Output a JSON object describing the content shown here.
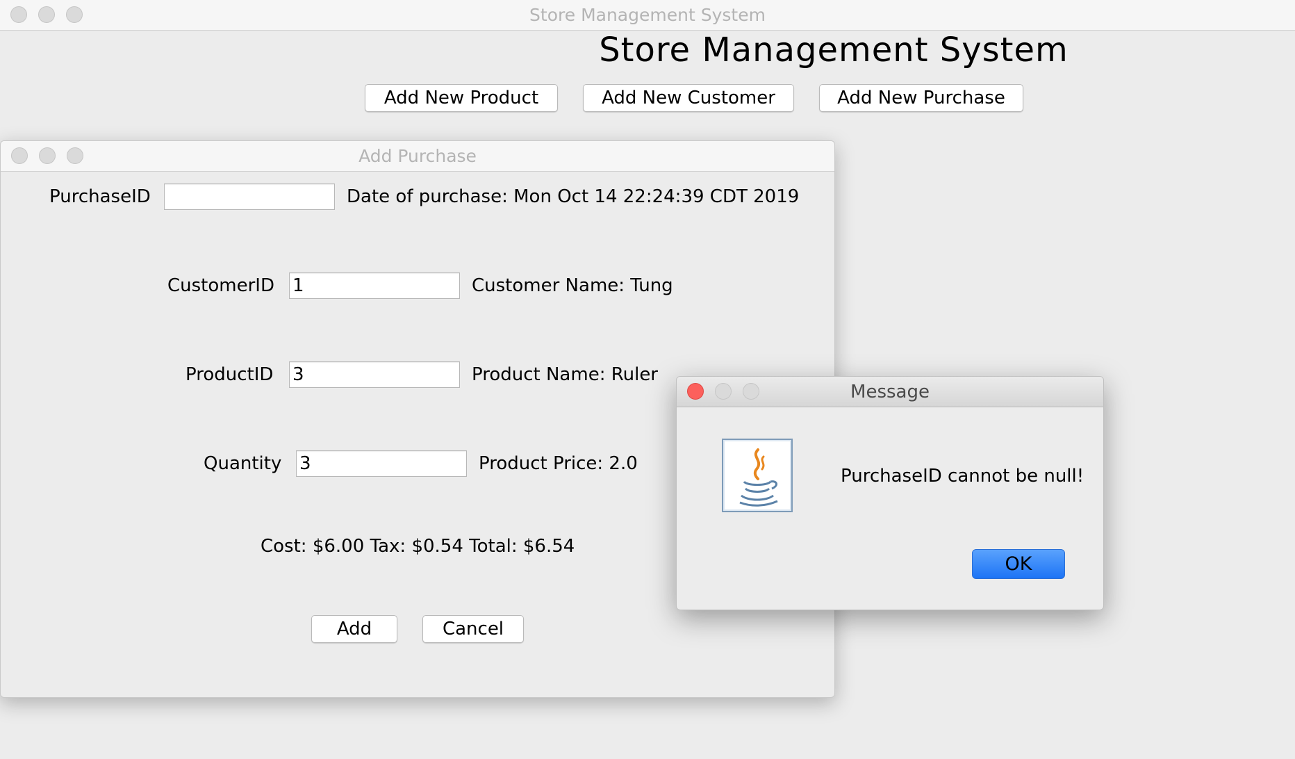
{
  "main_window": {
    "title": "Store Management System",
    "heading": "Store Management System",
    "buttons": {
      "add_product": "Add New Product",
      "add_customer": "Add New Customer",
      "add_purchase": "Add New Purchase"
    }
  },
  "purchase_window": {
    "title": "Add Purchase",
    "purchase_id": {
      "label": "PurchaseID",
      "value": ""
    },
    "date_text": "Date of purchase: Mon Oct 14 22:24:39 CDT 2019",
    "customer_id": {
      "label": "CustomerID",
      "value": "1"
    },
    "customer_name_text": "Customer Name: Tung",
    "product_id": {
      "label": "ProductID",
      "value": "3"
    },
    "product_name_text": "Product Name: Ruler",
    "quantity": {
      "label": "Quantity",
      "value": "3"
    },
    "product_price_text": "Product Price: 2.0",
    "totals_text": "Cost: $6.00 Tax: $0.54 Total: $6.54",
    "add_label": "Add",
    "cancel_label": "Cancel"
  },
  "message_dialog": {
    "title": "Message",
    "text": "PurchaseID cannot be null!",
    "ok_label": "OK",
    "icon": "java-icon"
  },
  "colors": {
    "close_red": "#fc605c",
    "accent_blue": "#1d74f5"
  }
}
